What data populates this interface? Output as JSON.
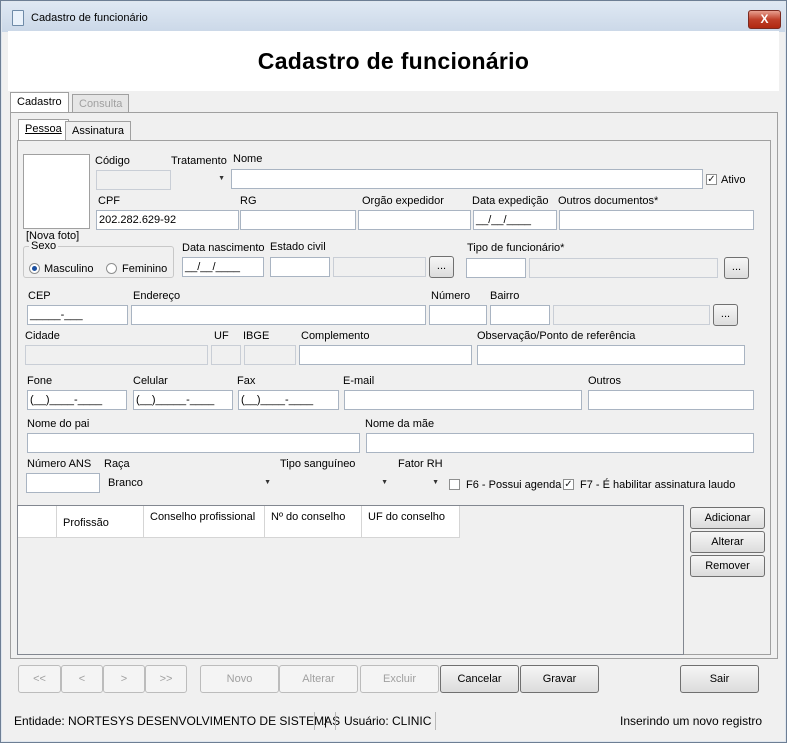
{
  "window": {
    "title": "Cadastro de funcionário",
    "close_label": "X"
  },
  "header": {
    "title": "Cadastro de funcionário"
  },
  "tabs": {
    "cadastro": "Cadastro",
    "consulta": "Consulta"
  },
  "subtabs": {
    "pessoa": "Pessoa",
    "assinatura": "Assinatura"
  },
  "form": {
    "nova_foto": "[Nova foto]",
    "codigo_label": "Código",
    "codigo_value": "",
    "tratamento_label": "Tratamento",
    "nome_label": "Nome",
    "ativo_label": "Ativo",
    "cpf_label": "CPF",
    "cpf_value": "202.282.629-92",
    "rg_label": "RG",
    "orgao_label": "Orgão expedidor",
    "data_exp_label": "Data expedição",
    "data_exp_value": "__/__/____",
    "outros_docs_label": "Outros documentos*",
    "sexo_label": "Sexo",
    "masculino_label": "Masculino",
    "feminino_label": "Feminino",
    "data_nasc_label": "Data nascimento",
    "data_nasc_value": "__/__/____",
    "estado_civil_label": "Estado civil",
    "tipo_func_label": "Tipo de funcionário*",
    "cep_label": "CEP",
    "cep_value": "_____-___",
    "endereco_label": "Endereço",
    "numero_label": "Número",
    "bairro_label": "Bairro",
    "cidade_label": "Cidade",
    "uf_label": "UF",
    "ibge_label": "IBGE",
    "complemento_label": "Complemento",
    "obs_label": "Observação/Ponto de referência",
    "fone_label": "Fone",
    "fone_value": "(__)____-____",
    "celular_label": "Celular",
    "celular_value": "(__)_____-____",
    "fax_label": "Fax",
    "fax_value": "(__)____-____",
    "email_label": "E-mail",
    "outros_label": "Outros",
    "pai_label": "Nome do pai",
    "mae_label": "Nome da mãe",
    "ans_label": "Número ANS",
    "raca_label": "Raça",
    "raca_value": "Branco",
    "sangue_label": "Tipo sanguíneo",
    "fator_label": "Fator RH",
    "f6_label": "F6 - Possui agenda",
    "f7_label": "F7 - É habilitar assinatura laudo",
    "dots": "..."
  },
  "table": {
    "headers": [
      "Profissão",
      "Conselho profissional",
      "Nº do conselho",
      "UF do conselho"
    ],
    "adicionar": "Adicionar",
    "alterar": "Alterar",
    "remover": "Remover"
  },
  "nav": {
    "first": "<<",
    "prev": "<",
    "next": ">",
    "last": ">>",
    "novo": "Novo",
    "alterar": "Alterar",
    "excluir": "Excluir",
    "cancelar": "Cancelar",
    "gravar": "Gravar",
    "sair": "Sair"
  },
  "status": {
    "entidade": "Entidade: NORTESYS DESENVOLVIMENTO DE SISTEMAS",
    "pipe": "|",
    "usuario": "Usuário: CLINIC",
    "mensagem": "Inserindo um novo registro"
  }
}
